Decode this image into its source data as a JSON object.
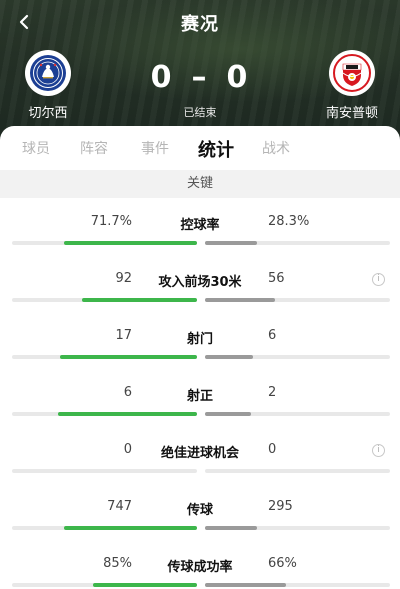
{
  "header": {
    "title": "赛况",
    "status": "已结束",
    "home_team": "切尔西",
    "away_team": "南安普顿",
    "home_score": "0",
    "score_separator": "–",
    "away_score": "0",
    "home_badge_icon": "chelsea-crest-icon",
    "away_badge_icon": "southampton-crest-icon"
  },
  "tabs": [
    {
      "label": "球员",
      "active": false
    },
    {
      "label": "阵容",
      "active": false
    },
    {
      "label": "事件",
      "active": false
    },
    {
      "label": "统计",
      "active": true
    },
    {
      "label": "战术",
      "active": false
    }
  ],
  "section_title": "关键",
  "colors": {
    "home_bar": "#3db64b",
    "away_bar": "#9a9a9a",
    "track": "#e8e8e8"
  },
  "stats": [
    {
      "label": "控球率",
      "home": "71.7%",
      "away": "28.3%",
      "home_share": 0.717,
      "away_share": 0.283,
      "info": false
    },
    {
      "label": "攻入前场30米",
      "home": "92",
      "away": "56",
      "home_share": 0.622,
      "away_share": 0.378,
      "info": true
    },
    {
      "label": "射门",
      "home": "17",
      "away": "6",
      "home_share": 0.739,
      "away_share": 0.261,
      "info": false
    },
    {
      "label": "射正",
      "home": "6",
      "away": "2",
      "home_share": 0.75,
      "away_share": 0.25,
      "info": false
    },
    {
      "label": "绝佳进球机会",
      "home": "0",
      "away": "0",
      "home_share": 0,
      "away_share": 0,
      "info": true
    },
    {
      "label": "传球",
      "home": "747",
      "away": "295",
      "home_share": 0.717,
      "away_share": 0.283,
      "info": false
    },
    {
      "label": "传球成功率",
      "home": "85%",
      "away": "66%",
      "home_share": 0.563,
      "away_share": 0.437,
      "info": false
    }
  ]
}
